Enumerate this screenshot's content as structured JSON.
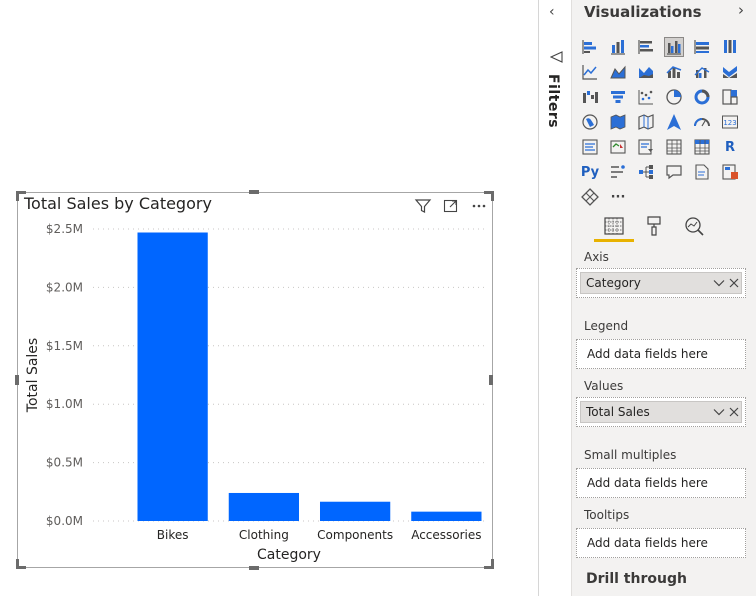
{
  "visual": {
    "title": "Total Sales by Category",
    "icons": [
      "filter-icon",
      "focus-mode-icon",
      "more-options-icon"
    ]
  },
  "chart_data": {
    "type": "bar",
    "title": "Total Sales by Category",
    "xlabel": "Category",
    "ylabel": "Total Sales",
    "categories": [
      "Bikes",
      "Clothing",
      "Components",
      "Accessories"
    ],
    "values": [
      2470000,
      240000,
      165000,
      80000
    ],
    "yticks": [
      "$0.0M",
      "$0.5M",
      "$1.0M",
      "$1.5M",
      "$2.0M",
      "$2.5M"
    ],
    "ytick_values": [
      0,
      500000,
      1000000,
      1500000,
      2000000,
      2500000
    ],
    "ylim": [
      0,
      2500000
    ],
    "grid": true,
    "color": "#0066ff"
  },
  "filters": {
    "label": "Filters",
    "collapse_glyph": "‹"
  },
  "viz_pane": {
    "title": "Visualizations",
    "expand_glyph": "›",
    "tabs": [
      "fields-icon",
      "format-icon",
      "analytics-icon"
    ],
    "r_label": "R",
    "py_label": "Py",
    "more_label": "···",
    "axis_label": "Axis",
    "axis_field": "Category",
    "legend_label": "Legend",
    "legend_placeholder": "Add data fields here",
    "values_label": "Values",
    "values_field": "Total Sales",
    "small_multiples_label": "Small multiples",
    "small_multiples_placeholder": "Add data fields here",
    "tooltips_label": "Tooltips",
    "tooltips_placeholder": "Add data fields here",
    "drill_through_label": "Drill through"
  },
  "colors": {
    "accent": "#e8b200",
    "bar": "#0066ff",
    "pane_bg": "#f3f2f1"
  }
}
